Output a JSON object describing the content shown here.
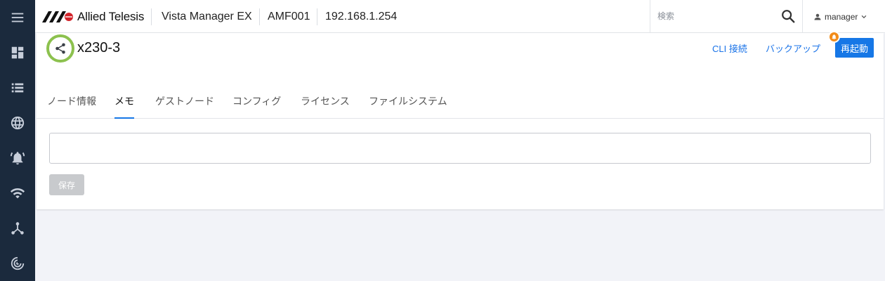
{
  "header": {
    "brand": "Allied Telesis",
    "product": "Vista Manager EX",
    "network": "AMF001",
    "ip": "192.168.1.254",
    "search_placeholder": "検索",
    "user": "manager"
  },
  "nav_icons": [
    "menu-icon",
    "dashboard-icon",
    "list-icon",
    "globe-icon",
    "alarm-icon",
    "wifi-icon",
    "topology-icon",
    "radar-icon"
  ],
  "node": {
    "name": "x230-3",
    "status_color": "#8cc14e"
  },
  "actions": {
    "cli": "CLI 接続",
    "backup": "バックアップ",
    "reboot": "再起動"
  },
  "tabs": [
    {
      "label": "ノード情報"
    },
    {
      "label": "メモ",
      "active": true
    },
    {
      "label": "ゲストノード"
    },
    {
      "label": "コンフィグ"
    },
    {
      "label": "ライセンス"
    },
    {
      "label": "ファイルシステム"
    }
  ],
  "memo": {
    "value": ""
  },
  "save_label": "保存",
  "colors": {
    "accent": "#1677e6",
    "nav": "#1b2a3d",
    "badge": "#f28c1a"
  }
}
